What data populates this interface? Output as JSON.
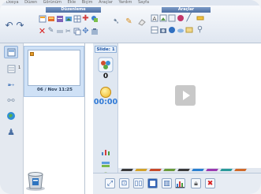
{
  "menu": [
    "Dosya",
    "Düzen",
    "Görünüm",
    "Ekle",
    "Biçim",
    "Araçlar",
    "Yardım",
    "Sayfa"
  ],
  "ribbon": {
    "group_edit_title": "Düzenleme",
    "group_tools_title": "Araçlar"
  },
  "colors": {
    "accent": "#4e6fa3",
    "play_gray": "#c8c8c8",
    "thumb_bg": "#cfe1f6",
    "counter_blue": "#2f79d6"
  },
  "slides_panel": {
    "slide_number": "1",
    "slide_caption": "06 / Nov 11:25"
  },
  "slide_panel": {
    "badge": "Slide: 1",
    "counter": "0",
    "timer": "00:00"
  },
  "icons": {
    "undo": "undo-icon",
    "redo": "redo-icon",
    "play": "play-icon",
    "trash": "trash-icon",
    "globe": "globe-icon",
    "chart": "bar-chart-icon",
    "close": "close-icon"
  }
}
